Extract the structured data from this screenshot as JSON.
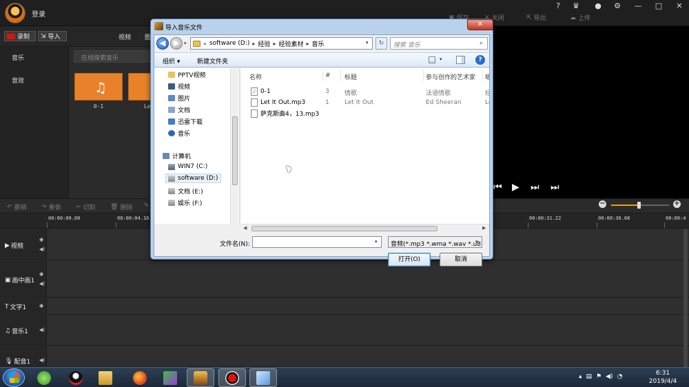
{
  "editor": {
    "login_label": "登录",
    "top_actions": [
      "保存",
      "关闭",
      "导出",
      "上传"
    ],
    "window_controls": [
      "?",
      "—",
      "□",
      "✕"
    ],
    "toolbar": {
      "record_label": "录制",
      "import_label": "导入"
    },
    "library_tabs": [
      "视频",
      "图"
    ],
    "nav_items": [
      "音乐",
      "音效"
    ],
    "search_placeholder": "在线搜索音乐",
    "media": [
      {
        "caption": "0-1"
      },
      {
        "caption": "Let I"
      }
    ],
    "timeline_tools": [
      "撤销",
      "重做",
      "切割",
      "删除"
    ],
    "zoom_level": 0.48,
    "ruler_ticks": [
      "00:00:00.00",
      "00:00:04.16",
      "00:00:31.22",
      "00:00:36.08",
      "00:00:4"
    ],
    "tracks": [
      "视频",
      "画中画1",
      "文字1",
      "音乐1",
      "配音1"
    ]
  },
  "dialog": {
    "title": "导入音乐文件",
    "close_glyph": "✕",
    "breadcrumb": [
      "software (D:)",
      "经验",
      "经验素材",
      "音乐"
    ],
    "breadcrumb_prefix": "«",
    "search_placeholder": "搜索 音乐",
    "commands": {
      "organize": "组织 ▾",
      "new_folder": "新建文件夹"
    },
    "help_glyph": "?",
    "nav": [
      "PPTV视频",
      "视频",
      "图片",
      "文档",
      "迅雷下载",
      "音乐",
      "计算机",
      "WIN7 (C:)",
      "software (D:)",
      "文档 (E:)",
      "娱乐 (F:)"
    ],
    "columns": {
      "name": "名称",
      "number": "#",
      "title": "标题",
      "artist": "参与创作的艺术家",
      "album": "唱"
    },
    "files": [
      {
        "name": "0-1",
        "number": "3",
        "title": "情歌",
        "artist": "法语情歌",
        "album": "经"
      },
      {
        "name": "Let It Out.mp3",
        "number": "1",
        "title": "Let It Out",
        "artist": "Ed Sheeran",
        "album": "Lo"
      },
      {
        "name": "萨克斯曲4，13.mp3",
        "number": "",
        "title": "",
        "artist": "",
        "album": ""
      }
    ],
    "filename_label": "文件名(N):",
    "filename_value": "",
    "filter": "音频(*.mp3 *.wma *.wav *.u8",
    "open_label": "打开(O)",
    "cancel_label": "取消"
  },
  "taskbar": {
    "time": "6:31",
    "date": "2019/4/4"
  }
}
